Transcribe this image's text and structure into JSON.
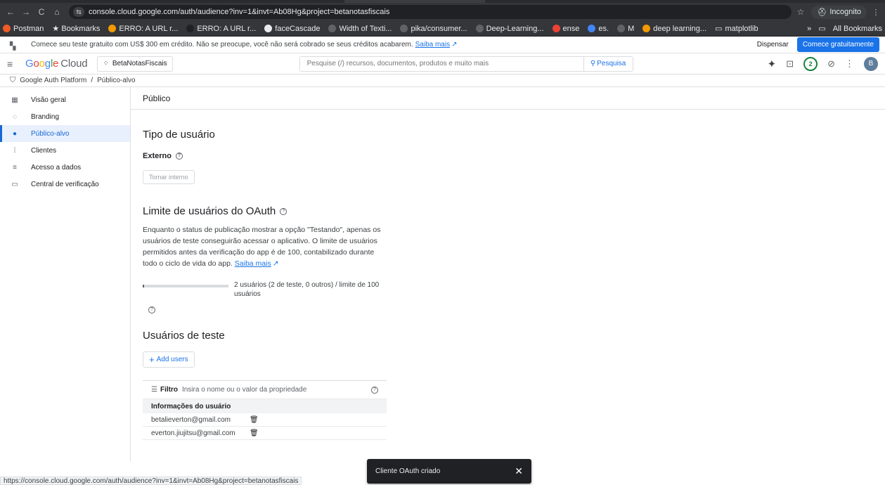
{
  "browser": {
    "url": "console.cloud.google.com/auth/audience?inv=1&invt=Ab08Hg&project=betanotasfiscais",
    "incognito_label": "Incognito",
    "bookmarks": [
      {
        "label": "Postman",
        "color": "#ef5b25"
      },
      {
        "label": "★ Bookmarks",
        "color": ""
      },
      {
        "label": "ERRO: A URL r...",
        "color": "#f29900"
      },
      {
        "label": "ERRO: A URL r...",
        "color": "#202124"
      },
      {
        "label": "faceCascade",
        "color": "#e8eaed"
      },
      {
        "label": "Width of Texti...",
        "color": "#5f6368"
      },
      {
        "label": "pika/consumer...",
        "color": "#5f6368"
      },
      {
        "label": "Deep-Learning...",
        "color": "#5f6368"
      },
      {
        "label": "ense",
        "color": "#ea4335"
      },
      {
        "label": "es.",
        "color": "#4285f4"
      },
      {
        "label": "M",
        "color": "#5f6368"
      },
      {
        "label": "deep learning...",
        "color": "#f29900"
      },
      {
        "label": "matplotlib",
        "color": ""
      }
    ],
    "all_bookmarks": "All Bookmarks",
    "status_url": "https://console.cloud.google.com/auth/audience?inv=1&invt=Ab08Hg&project=betanotasfiscais"
  },
  "banner": {
    "text": "Comece seu teste gratuito com US$ 300 em crédito. Não se preocupe, você não será cobrado se seus créditos acabarem.",
    "link": "Saiba mais",
    "dismiss": "Dispensar",
    "cta": "Comece gratuitamente"
  },
  "header": {
    "logo_cloud": "Cloud",
    "project": "BetaNotasFiscais",
    "search_placeholder": "Pesquise (/) recursos, documentos, produtos e muito mais",
    "search_button": "Pesquisa",
    "notifications": "2",
    "avatar_initial": "B"
  },
  "breadcrumb": {
    "root": "Google Auth Platform",
    "separator": "/",
    "current": "Público-alvo"
  },
  "sidebar": {
    "items": [
      {
        "label": "Visão geral",
        "icon": "▦",
        "active": false
      },
      {
        "label": "Branding",
        "icon": "◌",
        "active": false
      },
      {
        "label": "Público-alvo",
        "icon": "●",
        "active": true
      },
      {
        "label": "Clientes",
        "icon": "⁞",
        "active": false
      },
      {
        "label": "Acesso a dados",
        "icon": "≡",
        "active": false
      },
      {
        "label": "Central de verificação",
        "icon": "▭",
        "active": false
      }
    ]
  },
  "main": {
    "page_title": "Público",
    "user_type_heading": "Tipo de usuário",
    "user_type_value": "Externo",
    "make_internal_button": "Tornar interno",
    "oauth_limit_heading": "Limite de usuários do OAuth",
    "oauth_description": "Enquanto o status de publicação mostrar a opção \"Testando\", apenas os usuários de teste conseguirão acessar o aplicativo. O limite de usuários permitidos antes da verificação do app é de 100, contabilizado durante todo o ciclo de vida do app.",
    "oauth_link": "Saiba mais",
    "usage_text": "2 usuários (2 de teste, 0 outros) / limite de 100 usuários",
    "usage_fraction": 0.02,
    "test_users_heading": "Usuários de teste",
    "add_users_button": "Add users",
    "filter_label": "Filtro",
    "filter_placeholder": "Insira o nome ou o valor da propriedade",
    "table_header": "Informações do usuário",
    "users": [
      {
        "email": "betalieverton@gmail.com"
      },
      {
        "email": "everton.jiujitsu@gmail.com"
      }
    ]
  },
  "toast": {
    "message": "Cliente OAuth criado"
  }
}
